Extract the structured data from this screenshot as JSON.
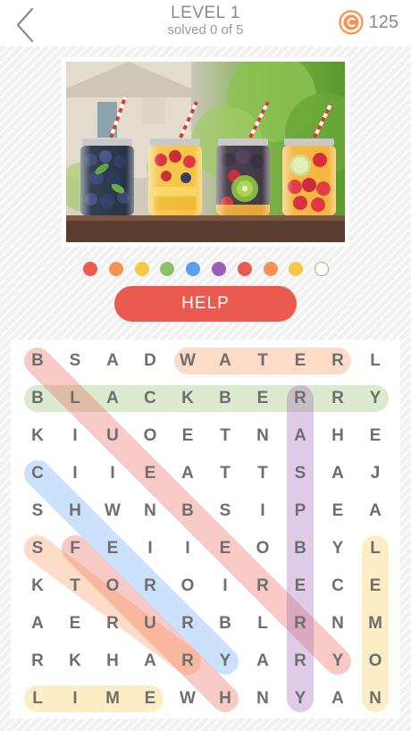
{
  "header": {
    "title": "LEVEL 1",
    "subtitle": "solved 0 of 5",
    "coins": "125"
  },
  "progress_dots": [
    {
      "color": "#ea5a4e",
      "filled": true
    },
    {
      "color": "#f5924f",
      "filled": true
    },
    {
      "color": "#f7c748",
      "filled": true
    },
    {
      "color": "#8fbf6a",
      "filled": true
    },
    {
      "color": "#5e9eef",
      "filled": true
    },
    {
      "color": "#9a5eb8",
      "filled": true
    },
    {
      "color": "#ea5a4e",
      "filled": true
    },
    {
      "color": "#f5924f",
      "filled": true
    },
    {
      "color": "#f7c748",
      "filled": true
    },
    {
      "color": "#8fbf6a",
      "filled": false
    }
  ],
  "help_label": "HELP",
  "grid": [
    "BSADWATERL",
    "BLACKBERRY",
    "KIUOETNAHE",
    "CIIEATTSAJ",
    "SHWNBSIPEA",
    "SFEIIEOBYL",
    "KTOROIRECE",
    "AERURBLRNM",
    "RKHARYARYO",
    "LIMEWHNYAN"
  ],
  "highlights": [
    {
      "color": "#f5924f",
      "from": [
        0,
        4
      ],
      "to": [
        0,
        8
      ]
    },
    {
      "color": "#8fbf6a",
      "from": [
        1,
        0
      ],
      "to": [
        1,
        9
      ]
    },
    {
      "color": "#ea5a4e",
      "from": [
        0,
        0
      ],
      "to": [
        8,
        8
      ]
    },
    {
      "color": "#9a5eb8",
      "from": [
        1,
        7
      ],
      "to": [
        9,
        7
      ]
    },
    {
      "color": "#5e9eef",
      "from": [
        3,
        0
      ],
      "to": [
        8,
        5
      ]
    },
    {
      "color": "#ea5a4e",
      "from": [
        5,
        1
      ],
      "to": [
        9,
        5
      ]
    },
    {
      "color": "#f5924f",
      "from": [
        5,
        0
      ],
      "to": [
        8,
        4
      ]
    },
    {
      "color": "#f7c748",
      "from": [
        5,
        9
      ],
      "to": [
        9,
        9
      ]
    },
    {
      "color": "#f7c748",
      "from": [
        9,
        0
      ],
      "to": [
        9,
        3
      ]
    }
  ]
}
